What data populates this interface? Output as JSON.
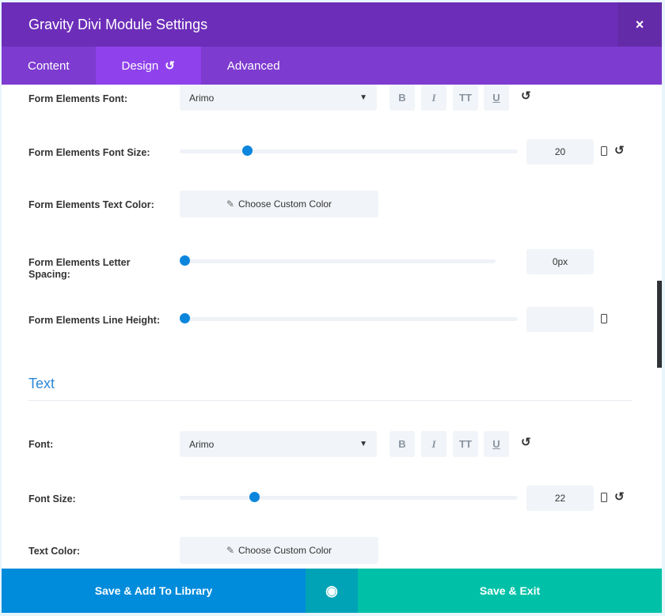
{
  "header": {
    "title": "Gravity Divi Module Settings",
    "close": "×"
  },
  "tabs": [
    {
      "label": "Content"
    },
    {
      "label": "Design",
      "reset_icon": "↺"
    },
    {
      "label": "Advanced"
    }
  ],
  "form_elements": {
    "font": {
      "label": "Form Elements Font:",
      "value": "Arimo",
      "styles": [
        "B",
        "I",
        "TT",
        "U"
      ]
    },
    "font_size": {
      "label": "Form Elements Font Size:",
      "value": "20",
      "slider_fraction": 0.2
    },
    "text_color": {
      "label": "Form Elements Text Color:",
      "button": "Choose Custom Color"
    },
    "letter_spacing": {
      "label": "Form Elements Letter Spacing:",
      "value": "0px",
      "slider_fraction": 0
    },
    "line_height": {
      "label": "Form Elements Line Height:",
      "value": "",
      "slider_fraction": 0
    }
  },
  "text_section": {
    "title": "Text",
    "font": {
      "label": "Font:",
      "value": "Arimo",
      "styles": [
        "B",
        "I",
        "TT",
        "U"
      ]
    },
    "font_size": {
      "label": "Font Size:",
      "value": "22",
      "slider_fraction": 0.22
    },
    "text_color": {
      "label": "Text Color:",
      "button": "Choose Custom Color"
    }
  },
  "footer": {
    "save_library": "Save & Add To Library",
    "save_exit": "Save & Exit"
  }
}
